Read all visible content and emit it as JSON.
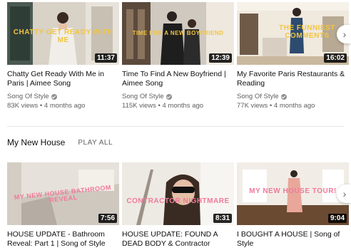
{
  "shelf_1": {
    "videos": [
      {
        "overlay": "CHATTY GET READY WITH ME",
        "duration": "11:37",
        "title": "Chatty Get Ready With Me in Paris | Aimee Song",
        "channel": "Song Of Style",
        "meta": "83K views • 4 months ago"
      },
      {
        "overlay": "TIME FOR A NEW BOYFRIEND",
        "duration": "12:39",
        "title": "Time To Find A New Boyfriend | Aimee Song",
        "channel": "Song Of Style",
        "meta": "115K views • 4 months ago"
      },
      {
        "overlay": "THE FUNNIEST COMMENTS",
        "duration": "16:02",
        "title": "My Favorite Paris Restaurants & Reading",
        "channel": "Song Of Style",
        "meta": "77K views • 4 months ago"
      }
    ]
  },
  "shelf_2": {
    "title": "My New House",
    "play_all": "PLAY ALL",
    "videos": [
      {
        "overlay": "MY NEW HOUSE BATHROOM REVEAL",
        "duration": "7:56",
        "title": "HOUSE UPDATE - Bathroom Reveal: Part 1 | Song of Style"
      },
      {
        "overlay": "CONTRACTOR NIGHTMARE",
        "duration": "8:31",
        "title": "HOUSE UPDATE: FOUND A DEAD BODY & Contractor"
      },
      {
        "overlay": "MY NEW HOUSE TOUR!",
        "duration": "9:04",
        "title": "I BOUGHT A HOUSE | Song of Style"
      }
    ]
  },
  "icons": {
    "next": "chevron-right-icon",
    "verified": "verified-check-icon"
  },
  "colors": {
    "overlay_yellow": "#f2c53d",
    "overlay_pink": "#f07a9a",
    "text_primary": "#0f0f0f",
    "text_secondary": "#606060"
  }
}
